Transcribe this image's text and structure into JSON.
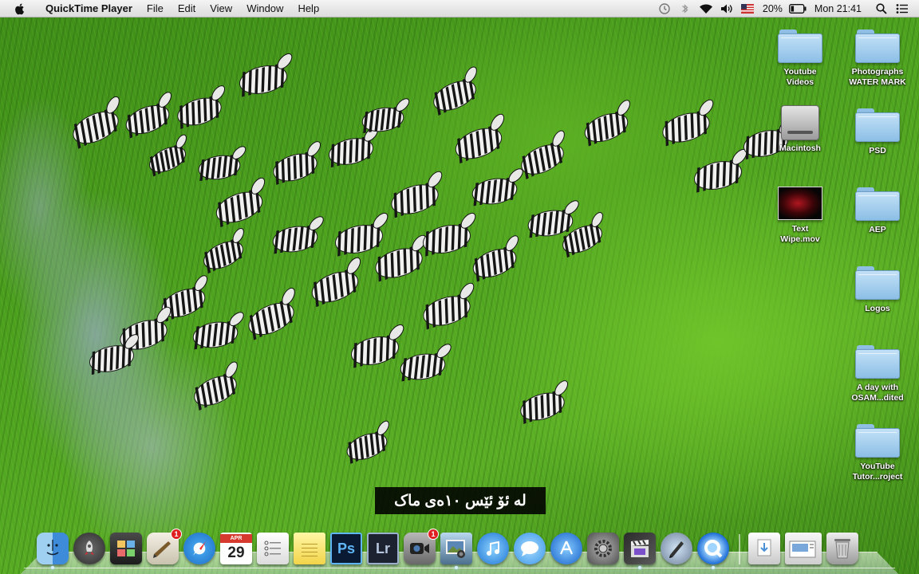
{
  "menubar": {
    "apple": "apple-icon",
    "app_name": "QuickTime Player",
    "menus": [
      "File",
      "Edit",
      "View",
      "Window",
      "Help"
    ],
    "status_icons": [
      "time-machine-icon",
      "bluetooth-icon",
      "wifi-icon",
      "volume-icon",
      "us-flag-input-icon"
    ],
    "battery": "20%",
    "clock": "Mon 21:41",
    "search": "spotlight-icon",
    "notifications": "notification-center-icon"
  },
  "desktop": {
    "icons": [
      {
        "label_lines": [
          "Youtube",
          "Videos"
        ],
        "type": "folder"
      },
      {
        "label_lines": [
          "Photographs",
          "WATER MARK"
        ],
        "type": "folder"
      },
      {
        "label_lines": [
          "Macintosh"
        ],
        "type": "drive"
      },
      {
        "label_lines": [
          "PSD"
        ],
        "type": "folder"
      },
      {
        "label_lines": [
          "Text",
          "Wipe.mov"
        ],
        "type": "movie"
      },
      {
        "label_lines": [
          "AEP"
        ],
        "type": "folder"
      },
      {
        "label_lines": [
          "Logos"
        ],
        "type": "folder"
      },
      {
        "label_lines": [
          "A day with",
          "OSAM...dited"
        ],
        "type": "folder"
      },
      {
        "label_lines": [
          "YouTube",
          "Tutor...roject"
        ],
        "type": "folder"
      }
    ]
  },
  "subtitle": "له ئۆ ئێس ١٠ەی ماک",
  "dock": {
    "apps": [
      {
        "name": "Finder",
        "icon": "finder-icon"
      },
      {
        "name": "Launchpad",
        "icon": "rocket-icon"
      },
      {
        "name": "Photo Booth",
        "icon": "photo-booth-icon"
      },
      {
        "name": "Mail",
        "icon": "mail-icon",
        "badge": "1"
      },
      {
        "name": "Safari",
        "icon": "compass-icon"
      },
      {
        "name": "Calendar",
        "icon": "calendar-icon",
        "month": "APR",
        "day": "29"
      },
      {
        "name": "Reminders",
        "icon": "reminders-icon"
      },
      {
        "name": "Notes",
        "icon": "notes-icon"
      },
      {
        "name": "Photoshop",
        "icon": "photoshop-icon",
        "text": "Ps"
      },
      {
        "name": "Lightroom",
        "icon": "lightroom-icon",
        "text": "Lr"
      },
      {
        "name": "FaceTime",
        "icon": "facetime-icon",
        "badge": "1"
      },
      {
        "name": "iPhoto",
        "icon": "iphoto-icon"
      },
      {
        "name": "iTunes",
        "icon": "music-note-icon"
      },
      {
        "name": "Messages",
        "icon": "chat-bubble-icon"
      },
      {
        "name": "App Store",
        "icon": "app-store-icon"
      },
      {
        "name": "System Preferences",
        "icon": "gear-icon"
      },
      {
        "name": "Final Cut Pro",
        "icon": "clapper-icon"
      },
      {
        "name": "Ink",
        "icon": "pen-icon"
      },
      {
        "name": "QuickTime Player",
        "icon": "quicktime-icon"
      }
    ],
    "stacks": [
      {
        "name": "Downloads",
        "icon": "downloads-stack-icon"
      },
      {
        "name": "Documents",
        "icon": "documents-stack-icon"
      },
      {
        "name": "Trash",
        "icon": "trash-icon"
      }
    ]
  },
  "colors": {
    "menubar_bg": "#e6e6e6",
    "grass": "#4da21f",
    "badge": "#e02020",
    "folder": "#a9d0ef"
  }
}
